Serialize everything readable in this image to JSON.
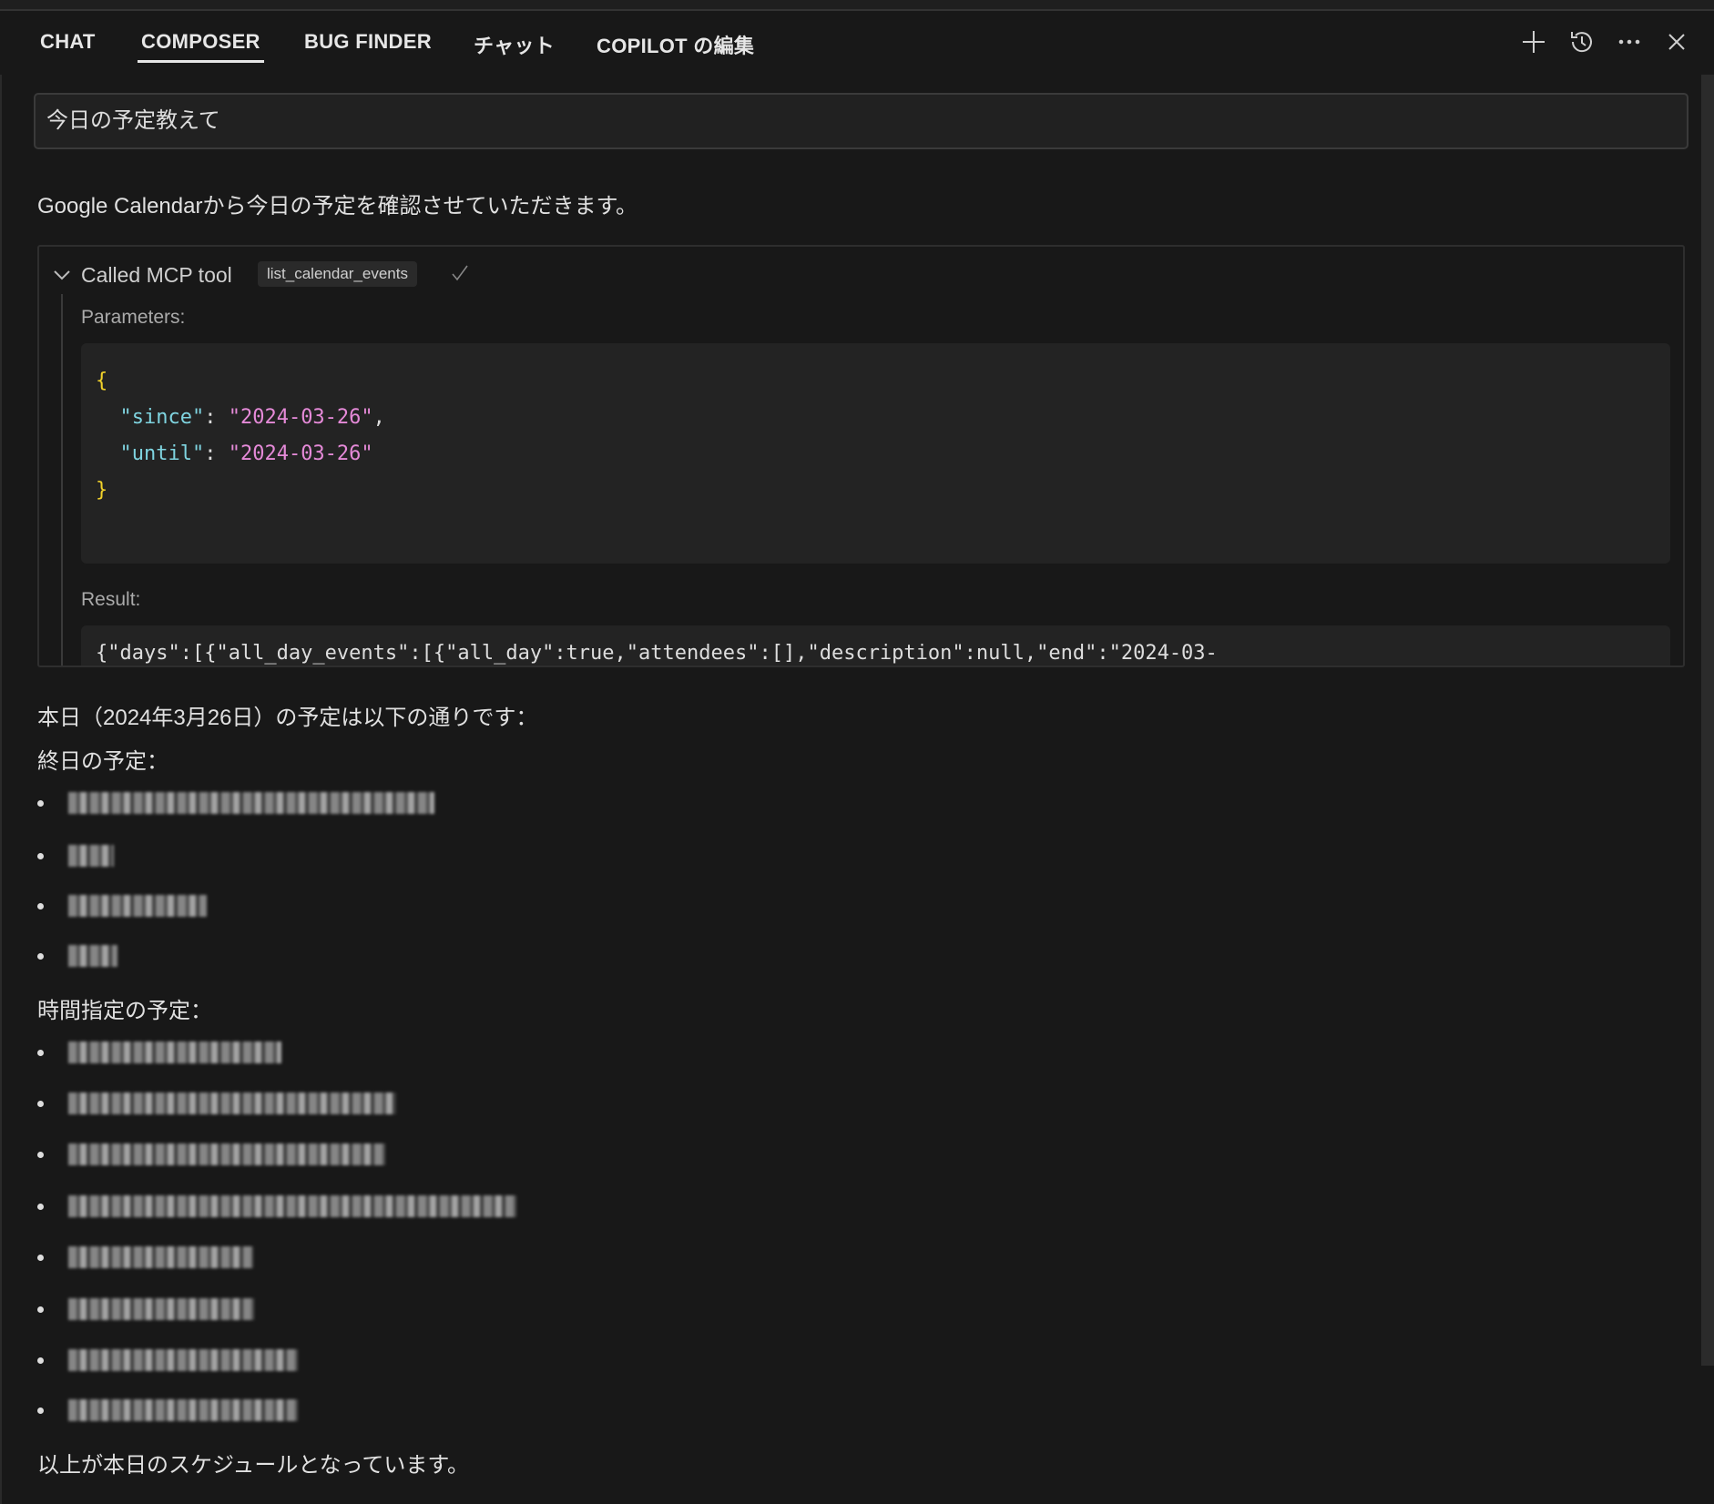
{
  "tabs": [
    {
      "label": "CHAT"
    },
    {
      "label": "COMPOSER",
      "active": true
    },
    {
      "label": "BUG FINDER"
    },
    {
      "label": "チャット"
    },
    {
      "label": "COPILOT の編集"
    }
  ],
  "toolbar_icons": [
    "plus-icon",
    "history-icon",
    "more-icon",
    "close-icon"
  ],
  "prompt": "今日の予定教えて",
  "intro": "Google Calendarから今日の予定を確認させていただきます。",
  "tool": {
    "called_label": "Called MCP tool",
    "name": "list_calendar_events",
    "parameters_label": "Parameters:",
    "params": {
      "since_key": "\"since\"",
      "since_val": "\"2024-03-26\"",
      "until_key": "\"until\"",
      "until_val": "\"2024-03-26\""
    },
    "result_label": "Result:",
    "result_text": "{\"days\":[{\"all_day_events\":[{\"all_day\":true,\"attendees\":[],\"description\":null,\"end\":\"2024-03-"
  },
  "answer": {
    "heading": "本日（2024年3月26日）の予定は以下の通りです：",
    "all_day_label": "終日の予定：",
    "timed_label": "時間指定の予定：",
    "closing": "以上が本日のスケジュールとなっています。"
  },
  "colors": {
    "background": "#181818",
    "json_key": "#7fd4e0",
    "json_string": "#e58ad8",
    "json_brace": "#f2d22a"
  }
}
